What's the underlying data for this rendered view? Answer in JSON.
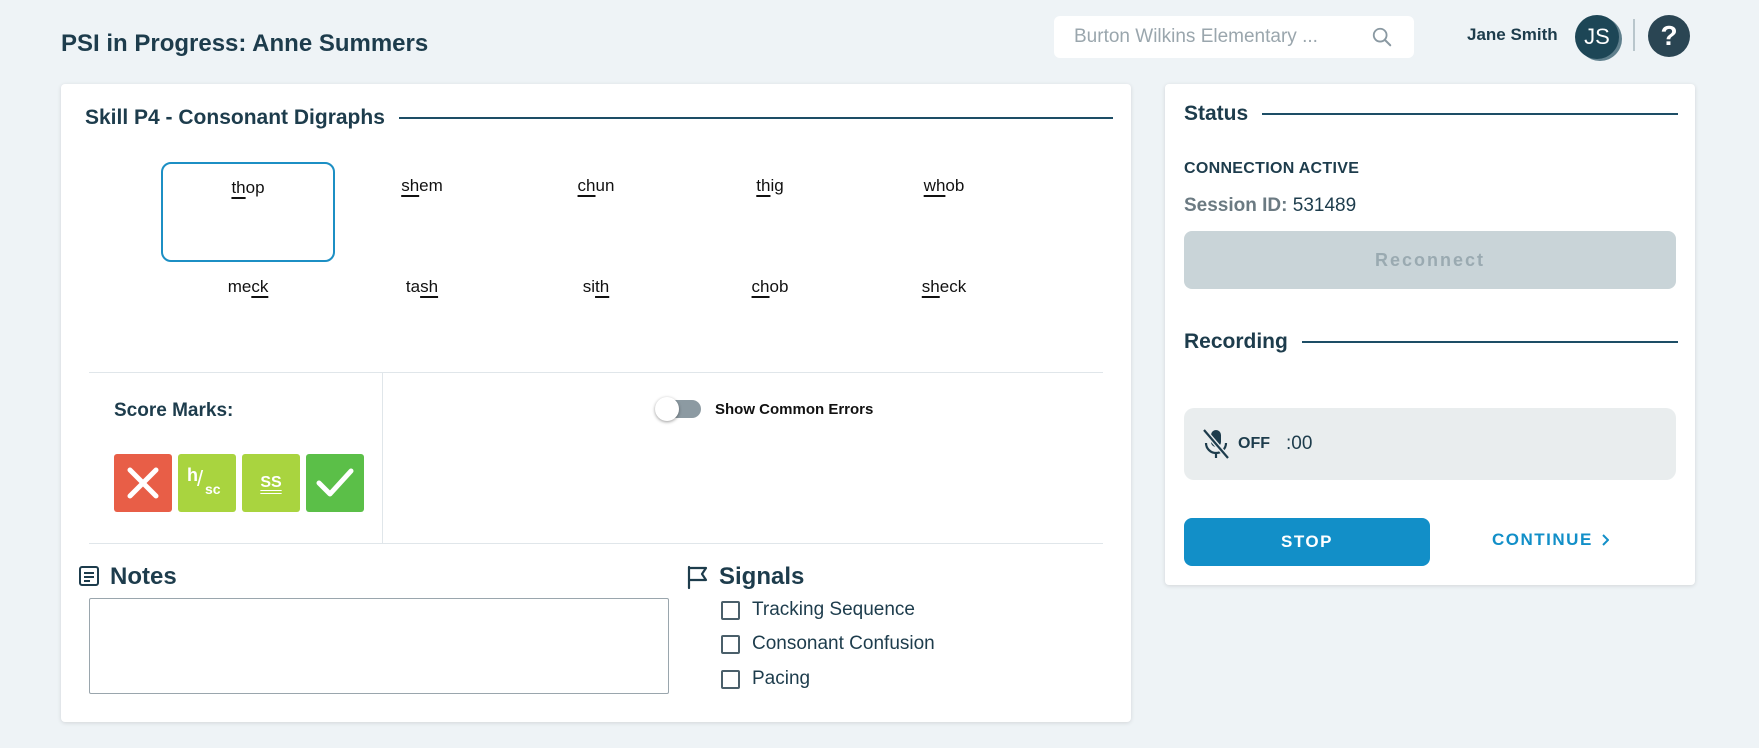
{
  "header": {
    "title": "PSI in Progress: Anne Summers",
    "search_placeholder": "Burton Wilkins Elementary ...",
    "user_name": "Jane Smith",
    "avatar_initials": "JS",
    "help_label": "?"
  },
  "skill": {
    "title": "Skill P4 - Consonant Digraphs",
    "words": [
      {
        "pre": "",
        "u": "th",
        "post": "op",
        "selected": true
      },
      {
        "pre": "",
        "u": "sh",
        "post": "em",
        "selected": false
      },
      {
        "pre": "",
        "u": "ch",
        "post": "un",
        "selected": false
      },
      {
        "pre": "",
        "u": "th",
        "post": "ig",
        "selected": false
      },
      {
        "pre": "",
        "u": "wh",
        "post": "ob",
        "selected": false
      },
      {
        "pre": "me",
        "u": "ck",
        "post": "",
        "selected": false
      },
      {
        "pre": "ta",
        "u": "sh",
        "post": "",
        "selected": false
      },
      {
        "pre": "si",
        "u": "th",
        "post": "",
        "selected": false
      },
      {
        "pre": "",
        "u": "ch",
        "post": "ob",
        "selected": false
      },
      {
        "pre": "",
        "u": "sh",
        "post": "eck",
        "selected": false
      }
    ]
  },
  "score": {
    "label": "Score Marks:",
    "hsc_label_h": "h",
    "hsc_label_sc": "sc",
    "ss_label": "SS",
    "colors": {
      "wrong": "#e85e47",
      "partial": "#a9d43f",
      "correct": "#5bbf48"
    }
  },
  "common_errors": {
    "label": "Show Common Errors",
    "enabled": false
  },
  "notes": {
    "title": "Notes",
    "value": ""
  },
  "signals": {
    "title": "Signals",
    "items": [
      "Tracking Sequence",
      "Consonant Confusion",
      "Pacing"
    ]
  },
  "status": {
    "title": "Status",
    "connection": "CONNECTION ACTIVE",
    "session_label": "Session ID:",
    "session_id": "531489",
    "reconnect_label": "Reconnect"
  },
  "recording": {
    "title": "Recording",
    "state": "OFF",
    "time": ":00",
    "stop_label": "STOP",
    "continue_label": "CONTINUE"
  }
}
